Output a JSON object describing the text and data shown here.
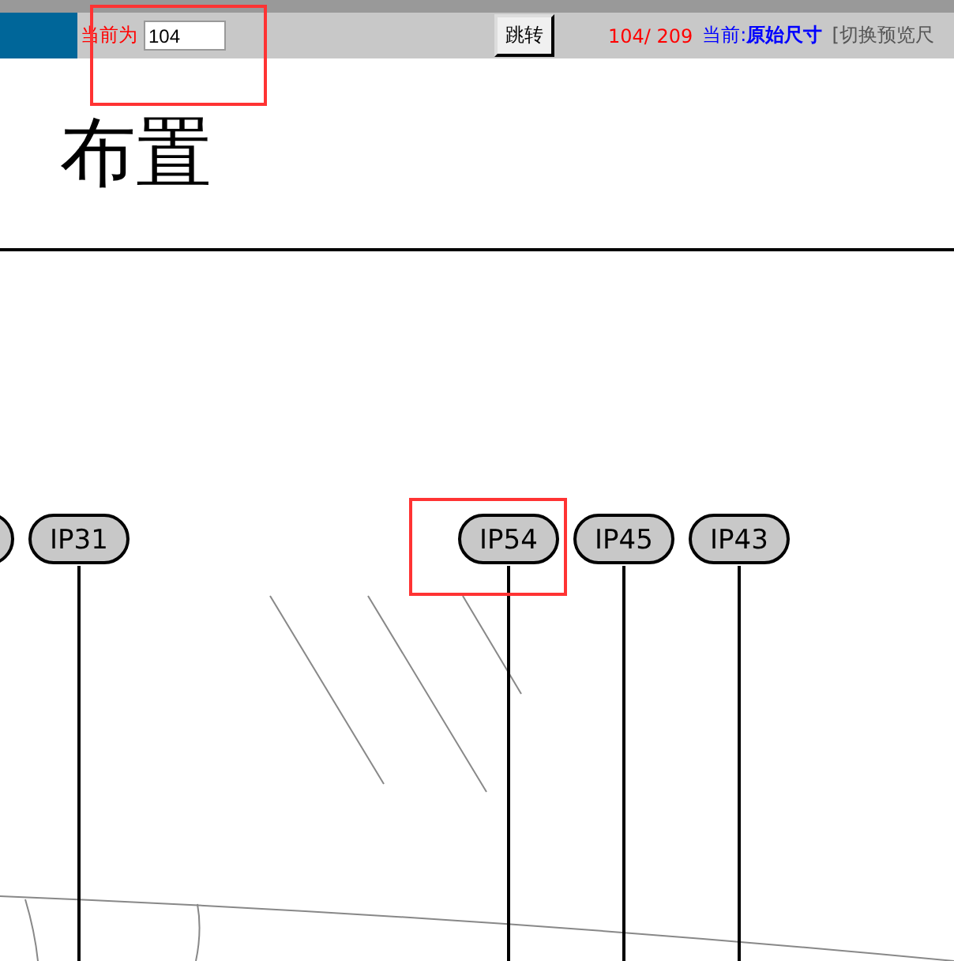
{
  "toolbar": {
    "page_label": "当前为",
    "page_input": "104",
    "jump_button": "跳转",
    "page_count": "104/ 209",
    "view_label": "当前:",
    "view_mode": "原始尺寸",
    "toggle_link": "[切换预览尺"
  },
  "title": "布置",
  "diagram": {
    "labels": [
      {
        "text": "IP31"
      },
      {
        "text": "IP54"
      },
      {
        "text": "IP45"
      },
      {
        "text": "IP43"
      }
    ]
  }
}
